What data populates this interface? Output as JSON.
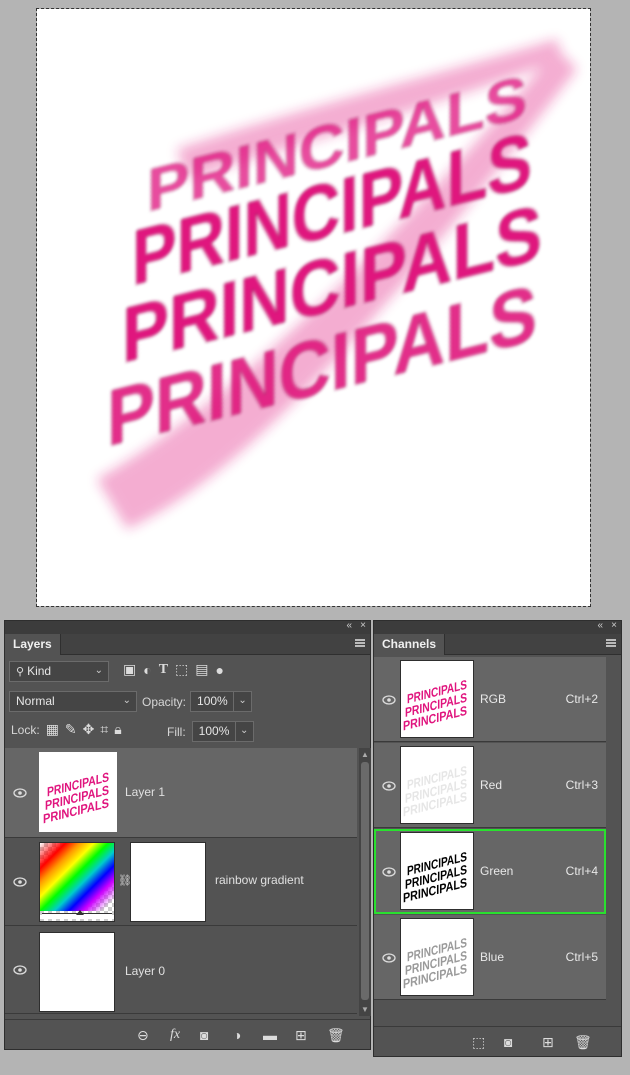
{
  "canvas": {
    "artwork_text": "PRINCIPALS",
    "artwork_color": "#e0157e"
  },
  "layers_panel": {
    "tab_label": "Layers",
    "collapse_glyph": "«",
    "close_glyph": "×",
    "filter_kind": "Kind",
    "blend_mode": "Normal",
    "opacity_label": "Opacity:",
    "opacity_value": "100%",
    "lock_label": "Lock:",
    "fill_label": "Fill:",
    "fill_value": "100%",
    "layers": [
      {
        "name": "Layer 1",
        "selected": true,
        "visible": true
      },
      {
        "name": "rainbow gradient",
        "selected": false,
        "visible": true
      },
      {
        "name": "Layer 0",
        "selected": false,
        "visible": true
      }
    ],
    "footer_icons": [
      "link-icon",
      "fx-icon",
      "mask-icon",
      "adjustment-icon",
      "folder-icon",
      "new-layer-icon",
      "trash-icon"
    ]
  },
  "channels_panel": {
    "tab_label": "Channels",
    "collapse_glyph": "«",
    "close_glyph": "×",
    "channels": [
      {
        "name": "RGB",
        "shortcut": "Ctrl+2",
        "visible": true
      },
      {
        "name": "Red",
        "shortcut": "Ctrl+3",
        "visible": true
      },
      {
        "name": "Green",
        "shortcut": "Ctrl+4",
        "visible": true,
        "highlight_color": "#29e02f"
      },
      {
        "name": "Blue",
        "shortcut": "Ctrl+5",
        "visible": true
      }
    ],
    "footer_icons": [
      "selection-icon",
      "mask-icon",
      "new-channel-icon",
      "trash-icon"
    ]
  }
}
